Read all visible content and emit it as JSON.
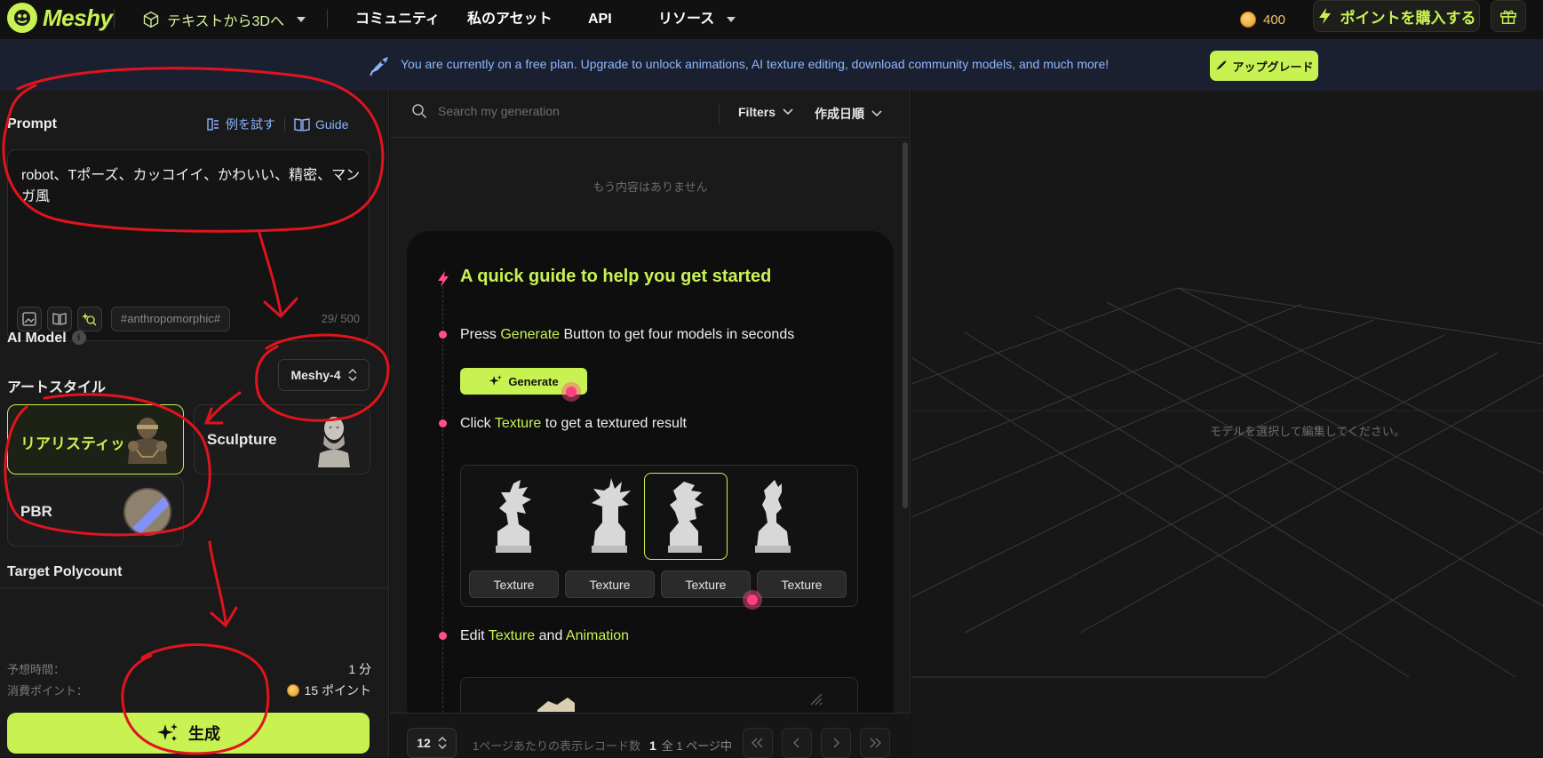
{
  "nav": {
    "brand": "Meshy",
    "mode": "テキストから3Dへ",
    "links": [
      "コミュニティ",
      "私のアセット",
      "API",
      "リソース"
    ],
    "points": "400",
    "buy_label": "ポイントを購入する"
  },
  "banner": {
    "message": "You are currently on a free plan. Upgrade to unlock animations, AI texture editing, download community models, and much more!",
    "upgrade_label": "アップグレード"
  },
  "left": {
    "prompt_label": "Prompt",
    "try_example": "例を試す",
    "guide": "Guide",
    "prompt_value": "robot、Tポーズ、カッコイイ、かわいい、精密、マンガ風",
    "tag": "#anthropomorphic#",
    "counter": "29/ 500",
    "ai_model_label": "AI Model",
    "ai_model_value": "Meshy-4",
    "art_style_label": "アートスタイル",
    "styles": [
      "リアリスティック",
      "Sculpture",
      "PBR"
    ],
    "target_polycount_label": "Target Polycount",
    "est_time_label": "予想時間：",
    "est_time_value": "1 分",
    "cost_label": "消費ポイント：",
    "cost_value": "15 ポイント",
    "generate_label": "生成"
  },
  "middle": {
    "search_placeholder": "Search my generation",
    "filters": "Filters",
    "sort": "作成日順",
    "no_more": "もう内容はありません",
    "guide_title": "A quick guide to help you get started",
    "step1_a": "Press ",
    "step1_hl": "Generate",
    "step1_b": " Button to get four models in seconds",
    "mini_generate": "Generate",
    "step2_a": "Click ",
    "step2_hl": "Texture",
    "step2_b": " to get a textured result",
    "texture_btns": [
      "Texture",
      "Texture",
      "Texture",
      "Texture"
    ],
    "step3_a": "Edit ",
    "step3_hl1": "Texture",
    "step3_b": " and ",
    "step3_hl2": "Animation",
    "per_page_value": "12",
    "per_page_label": "1ページあたりの表示レコード数",
    "page_current": "1",
    "page_total": "全 1 ページ中"
  },
  "right": {
    "hint": "モデルを選択して編集してください。"
  },
  "colors": {
    "accent": "#c8f252",
    "link": "#8db4ff",
    "step_dot": "#ff4f86",
    "annotation": "#e0141e"
  }
}
